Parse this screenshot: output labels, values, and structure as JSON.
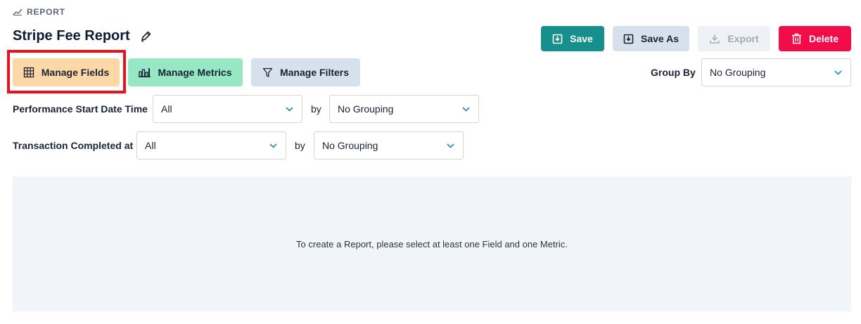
{
  "header": {
    "section_label": "REPORT",
    "section_icon": "trend-line-icon",
    "title": "Stripe Fee Report",
    "edit_icon": "pencil-icon"
  },
  "actions": {
    "save": "Save",
    "save_as": "Save As",
    "export": "Export",
    "export_disabled": true,
    "delete": "Delete"
  },
  "toolbar": {
    "manage_fields": "Manage Fields",
    "manage_metrics": "Manage Metrics",
    "manage_filters": "Manage Filters",
    "group_by_label": "Group By",
    "group_by_value": "No Grouping"
  },
  "filters": [
    {
      "label": "Performance Start Date Time",
      "value": "All",
      "by_label": "by",
      "grouping": "No Grouping"
    },
    {
      "label": "Transaction Completed at",
      "value": "All",
      "by_label": "by",
      "grouping": "No Grouping"
    }
  ],
  "empty_state": {
    "message": "To create a Report, please select at least one Field and one Metric."
  },
  "colors": {
    "save": "#178f8c",
    "save_as": "#d7e1ec",
    "export": "#eef2f6",
    "delete": "#f20d4a",
    "manage_fields": "#fdd8a7",
    "manage_metrics": "#96e8c5",
    "manage_filters": "#d7e1ec",
    "highlight": "#e8121c",
    "chevron": "#1b8fa5",
    "panel": "#f1f5fa"
  }
}
